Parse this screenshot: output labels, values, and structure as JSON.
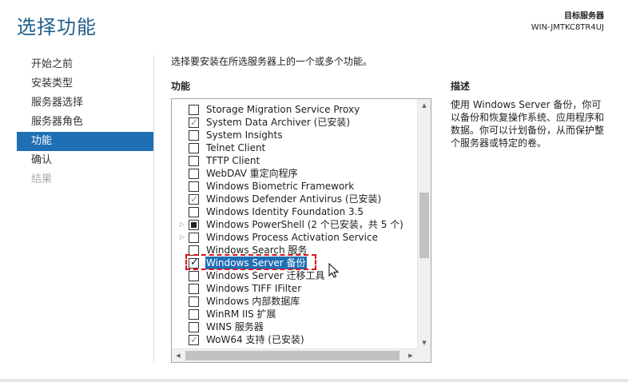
{
  "header": {
    "title": "选择功能",
    "destination_label": "目标服务器",
    "destination_server": "WIN-JMTKC8TR4UJ"
  },
  "nav": {
    "items": [
      {
        "label": "开始之前",
        "state": "normal"
      },
      {
        "label": "安装类型",
        "state": "normal"
      },
      {
        "label": "服务器选择",
        "state": "normal"
      },
      {
        "label": "服务器角色",
        "state": "normal"
      },
      {
        "label": "功能",
        "state": "active"
      },
      {
        "label": "确认",
        "state": "normal"
      },
      {
        "label": "结果",
        "state": "disabled"
      }
    ]
  },
  "main": {
    "instruction": "选择要安装在所选服务器上的一个或多个功能。",
    "features_header": "功能",
    "description_header": "描述",
    "description_text": "使用 Windows Server 备份，你可以备份和恢复操作系统、应用程序和数据。你可以计划备份，从而保护整个服务器或特定的卷。",
    "features": [
      {
        "label": "Storage Migration Service Proxy",
        "state": "unchecked",
        "expander": ""
      },
      {
        "label": "System Data Archiver (已安装)",
        "state": "checked-grey",
        "expander": ""
      },
      {
        "label": "System Insights",
        "state": "unchecked",
        "expander": ""
      },
      {
        "label": "Telnet Client",
        "state": "unchecked",
        "expander": ""
      },
      {
        "label": "TFTP Client",
        "state": "unchecked",
        "expander": ""
      },
      {
        "label": "WebDAV 重定向程序",
        "state": "unchecked",
        "expander": ""
      },
      {
        "label": "Windows Biometric Framework",
        "state": "unchecked",
        "expander": ""
      },
      {
        "label": "Windows Defender Antivirus (已安装)",
        "state": "checked-grey",
        "expander": ""
      },
      {
        "label": "Windows Identity Foundation 3.5",
        "state": "unchecked",
        "expander": ""
      },
      {
        "label": "Windows PowerShell (2 个已安装，共 5 个)",
        "state": "partial",
        "expander": "▷"
      },
      {
        "label": "Windows Process Activation Service",
        "state": "unchecked",
        "expander": "▷"
      },
      {
        "label": "Windows Search 服务",
        "state": "unchecked",
        "expander": ""
      },
      {
        "label": "Windows Server 备份",
        "state": "checked",
        "expander": "",
        "selected": true
      },
      {
        "label": "Windows Server 迁移工具",
        "state": "unchecked",
        "expander": ""
      },
      {
        "label": "Windows TIFF IFilter",
        "state": "unchecked",
        "expander": ""
      },
      {
        "label": "Windows 内部数据库",
        "state": "unchecked",
        "expander": ""
      },
      {
        "label": "WinRM IIS 扩展",
        "state": "unchecked",
        "expander": ""
      },
      {
        "label": "WINS 服务器",
        "state": "unchecked",
        "expander": ""
      },
      {
        "label": "WoW64 支持 (已安装)",
        "state": "checked-grey",
        "expander": ""
      }
    ]
  },
  "colors": {
    "accent": "#1f6fb5",
    "title": "#1f5f8e",
    "highlight": "#e0151b"
  },
  "icons": {
    "scroll_up": "chevron-up-icon",
    "scroll_down": "chevron-down-icon",
    "scroll_left": "chevron-left-icon",
    "scroll_right": "chevron-right-icon",
    "expander": "triangle-right-icon",
    "cursor": "mouse-pointer-icon"
  }
}
